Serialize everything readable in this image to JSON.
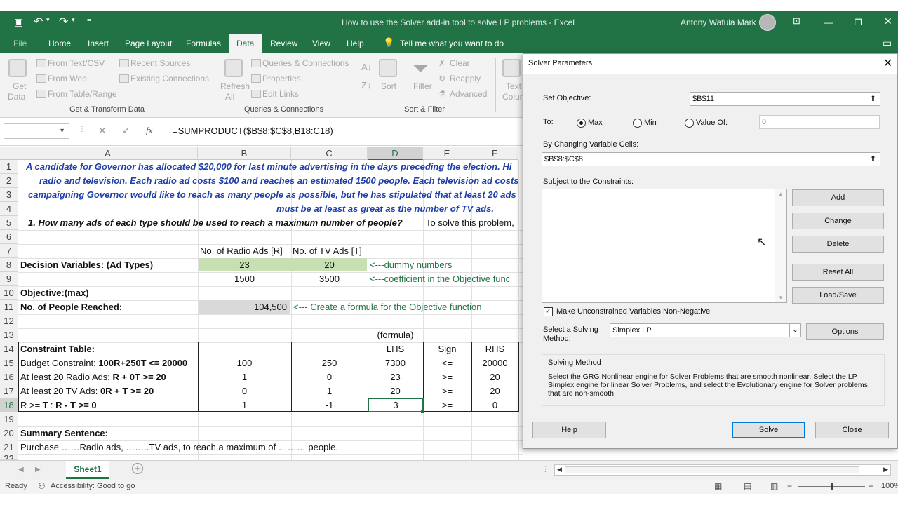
{
  "window": {
    "title": "How to use the Solver add-in tool to solve LP problems  -  Excel",
    "user": "Antony Wafula Mark"
  },
  "tabs": [
    "File",
    "Home",
    "Insert",
    "Page Layout",
    "Formulas",
    "Data",
    "Review",
    "View",
    "Help"
  ],
  "tell_me": "Tell me what you want to do",
  "ribbon": {
    "get_data": [
      "Get",
      "Data"
    ],
    "from_text": "From Text/CSV",
    "from_web": "From Web",
    "from_table": "From Table/Range",
    "recent_sources": "Recent Sources",
    "existing_connections": "Existing Connections",
    "group1": "Get & Transform Data",
    "refresh_all": [
      "Refresh",
      "All"
    ],
    "queries_connections": "Queries & Connections",
    "properties": "Properties",
    "edit_links": "Edit Links",
    "group2": "Queries & Connections",
    "sort": "Sort",
    "filter": "Filter",
    "clear": "Clear",
    "reapply": "Reapply",
    "advanced": "Advanced",
    "group3": "Sort & Filter",
    "text_columns": [
      "Text",
      "Colum"
    ]
  },
  "formula_bar": {
    "formula": "=SUMPRODUCT($B$8:$C$8,B18:C18)"
  },
  "columns": [
    "A",
    "B",
    "C",
    "D",
    "E",
    "F"
  ],
  "rows": [
    "1",
    "2",
    "3",
    "4",
    "5",
    "6",
    "7",
    "8",
    "9",
    "10",
    "11",
    "12",
    "13",
    "14",
    "15",
    "16",
    "17",
    "18",
    "19",
    "20",
    "21",
    "22"
  ],
  "cells": {
    "r1": "A candidate for Governor has allocated $20,000 for last minute advertising in the days preceding the election.  Hi",
    "r2": "radio and television. Each radio ad costs $100 and reaches an estimated 1500 people.  Each television ad costs",
    "r3": "campaigning Governor would like to reach as many people as possible, but he has stipulated that at least 20 ads",
    "r4": "must be at least as great as the number of TV ads.",
    "r5a": "1. How many ads of each type should be used to reach a maximum number of people?",
    "r5b": "To solve this problem,",
    "r7b": "No. of Radio Ads [R]",
    "r7c": "No. of TV Ads [T]",
    "r8a": "Decision Variables: (Ad Types)",
    "r8b": "23",
    "r8c": "20",
    "r8d": "<---dummy numbers",
    "r9b": "1500",
    "r9c": "3500",
    "r9d": "<---coefficient in the Objective func",
    "r10a": "Objective:(max)",
    "r11a": "No. of People Reached:",
    "r11b": "104,500",
    "r11c": "<--- Create a formula for the Objective function",
    "r13d": "(formula)",
    "r14a": "Constraint Table:",
    "r14d": "LHS",
    "r14e": "Sign",
    "r14f": "RHS",
    "r15a1": "Budget Constraint: ",
    "r15a2": "100R+250T <= 20000",
    "r15b": "100",
    "r15c": "250",
    "r15d": "7300",
    "r15e": "<=",
    "r15f": "20000",
    "r16a1": "At least 20 Radio Ads: ",
    "r16a2": "R + 0T >= 20",
    "r16b": "1",
    "r16c": "0",
    "r16d": "23",
    "r16e": ">=",
    "r16f": "20",
    "r17a1": "At least 20 TV Ads: ",
    "r17a2": "0R + T >= 20",
    "r17b": "0",
    "r17c": "1",
    "r17d": "20",
    "r17e": ">=",
    "r17f": "20",
    "r18a1": "R >= T : ",
    "r18a2": "R - T >= 0",
    "r18b": "1",
    "r18c": "-1",
    "r18d": "3",
    "r18e": ">=",
    "r18f": "0",
    "r20a": "Summary Sentence:",
    "r21a": "Purchase ……Radio ads, ……..TV ads, to reach a maximum of ……… people."
  },
  "sheet_tab": "Sheet1",
  "status": {
    "ready": "Ready",
    "accessibility": "Accessibility: Good to go",
    "zoom": "100%"
  },
  "solver": {
    "title": "Solver Parameters",
    "set_objective_label": "Set Objective:",
    "set_objective_value": "$B$11",
    "to_label": "To:",
    "max": "Max",
    "min": "Min",
    "value_of": "Value Of:",
    "value_of_value": "0",
    "changing_label": "By Changing Variable Cells:",
    "changing_value": "$B$8:$C$8",
    "subject_label": "Subject to the Constraints:",
    "add": "Add",
    "change": "Change",
    "delete": "Delete",
    "reset_all": "Reset All",
    "load_save": "Load/Save",
    "nonneg_label": "Make Unconstrained Variables Non-Negative",
    "method_label": "Select a Solving Method:",
    "method_value": "Simplex LP",
    "options": "Options",
    "solving_method_title": "Solving Method",
    "solving_method_text": "Select the GRG Nonlinear engine for Solver Problems that are smooth nonlinear. Select the LP Simplex engine for linear Solver Problems, and select the Evolutionary engine for Solver problems that are non-smooth.",
    "help": "Help",
    "solve": "Solve",
    "close": "Close"
  }
}
